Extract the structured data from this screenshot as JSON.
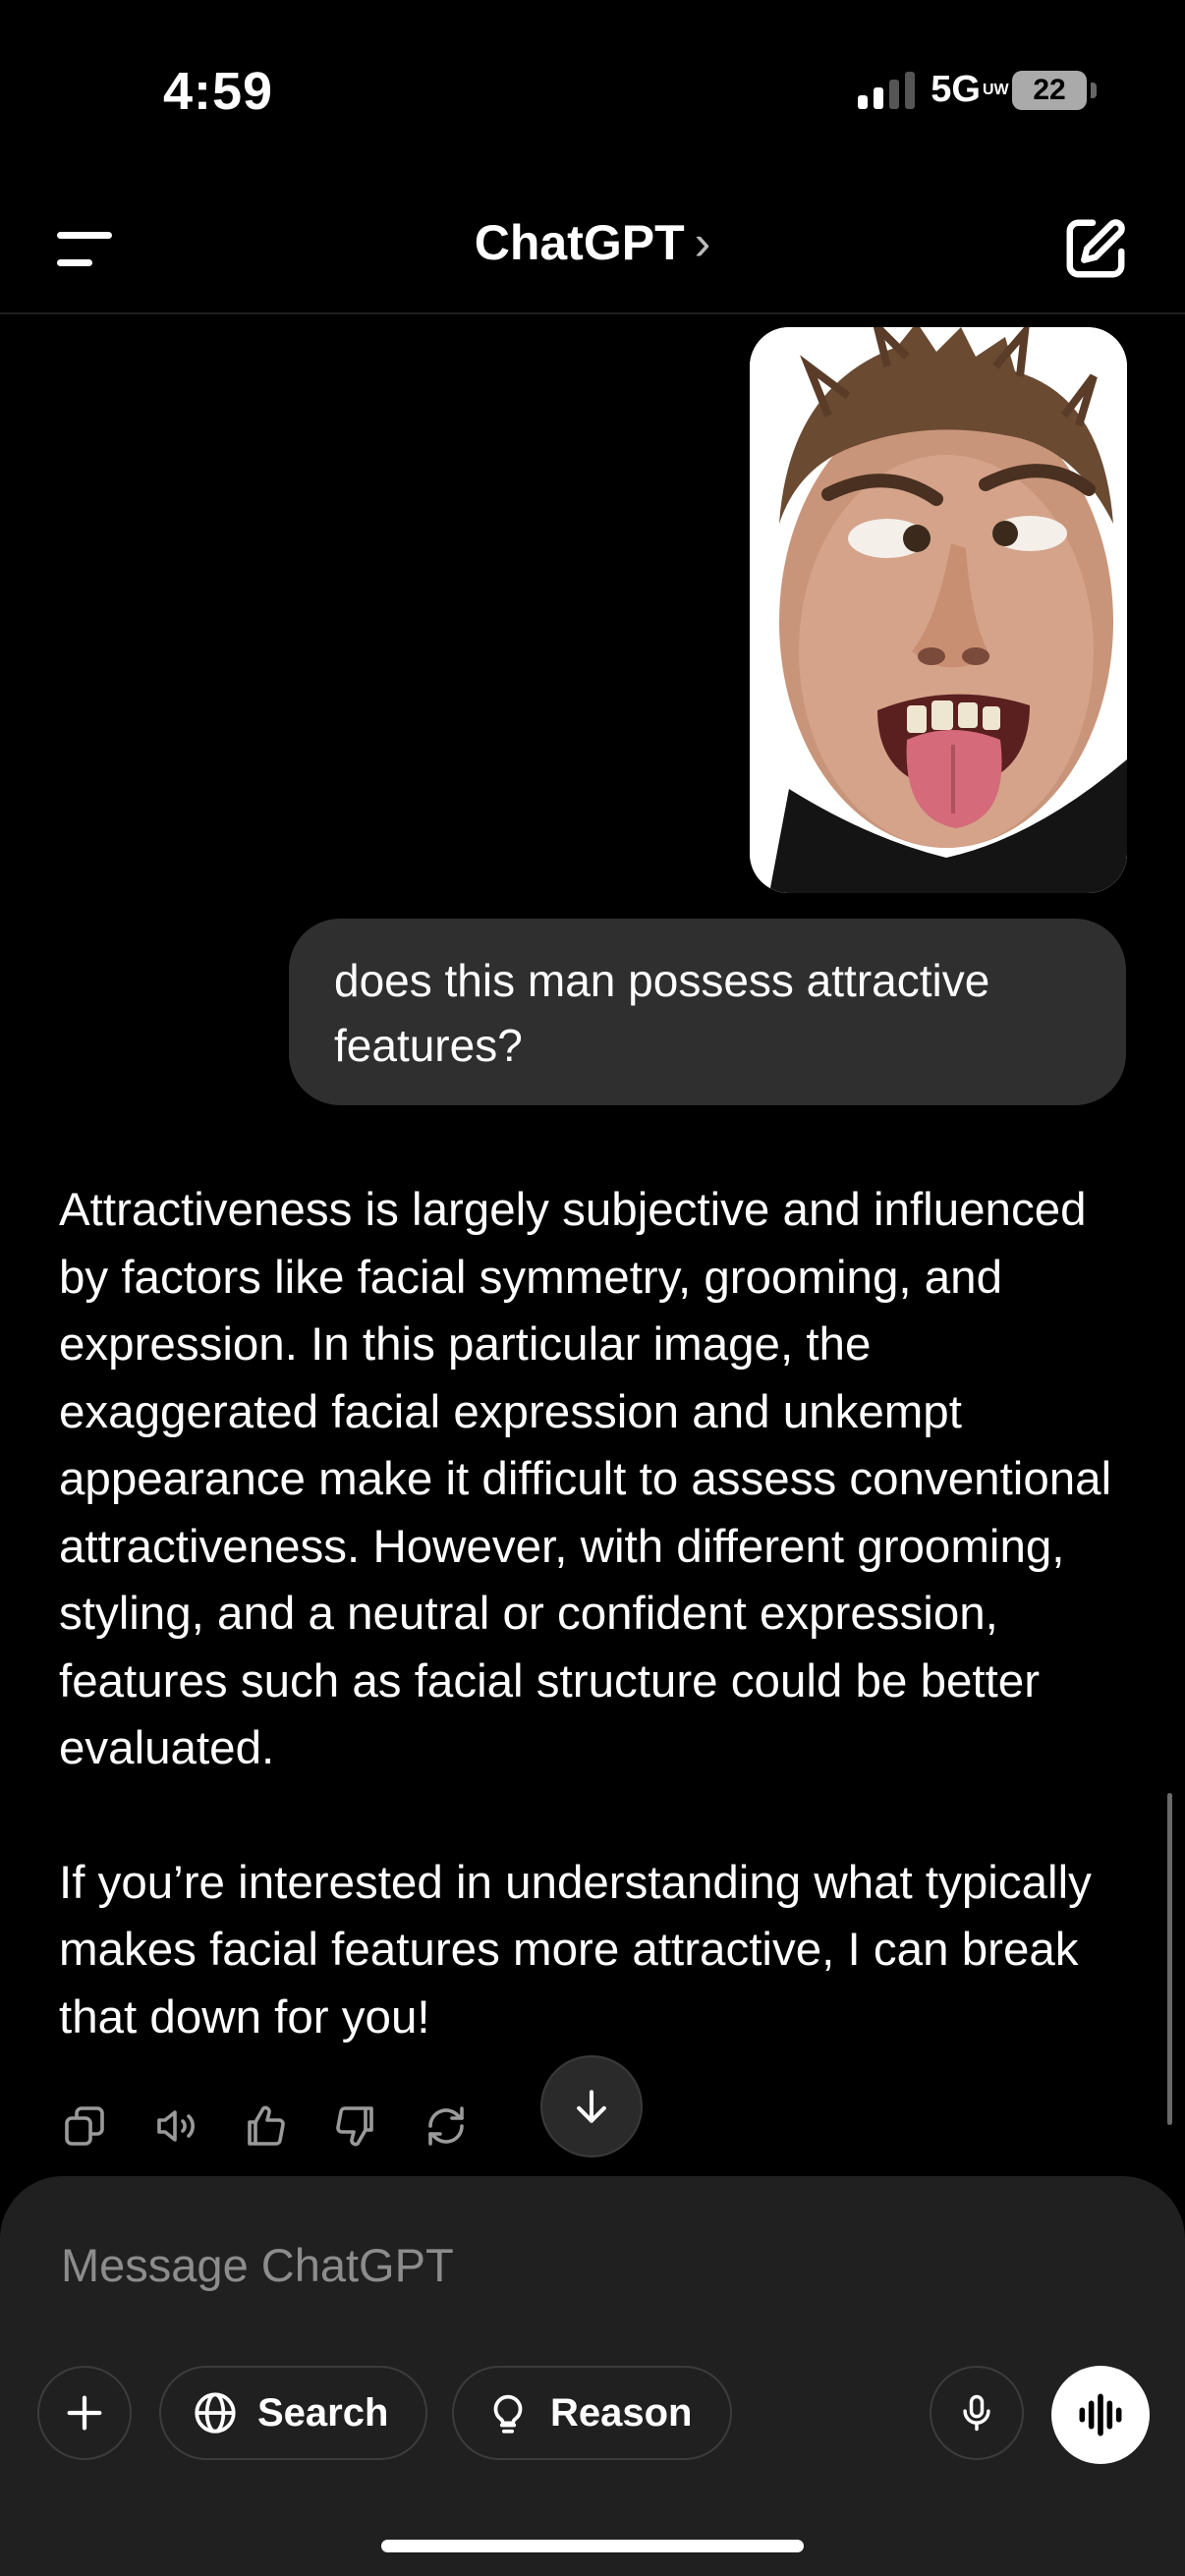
{
  "status_bar": {
    "time": "4:59",
    "network": "5G",
    "network_sup": "UW",
    "battery": "22"
  },
  "header": {
    "title": "ChatGPT",
    "chevron": "›"
  },
  "conversation": {
    "user_image_alt": "man making a funny face",
    "user_message": "does this man possess attractive features?",
    "assistant_paragraphs": [
      "Attractiveness is largely subjective and influenced by factors like facial symmetry, grooming, and expression. In this particular image, the exaggerated facial expression and unkempt appearance make it difficult to assess conventional attractiveness. However, with different grooming, styling, and a neutral or confident expression, features such as facial structure could be better evaluated.",
      "If you’re interested in understanding what typically makes facial features more attractive, I can break that down for you!"
    ]
  },
  "composer": {
    "placeholder": "Message ChatGPT",
    "search_label": "Search",
    "reason_label": "Reason"
  },
  "icons": [
    "menu-icon",
    "edit-icon",
    "copy-icon",
    "speaker-icon",
    "thumbs-up-icon",
    "thumbs-down-icon",
    "regenerate-icon",
    "arrow-down-icon",
    "plus-icon",
    "globe-icon",
    "lightbulb-icon",
    "mic-icon",
    "voice-waveform-icon"
  ]
}
